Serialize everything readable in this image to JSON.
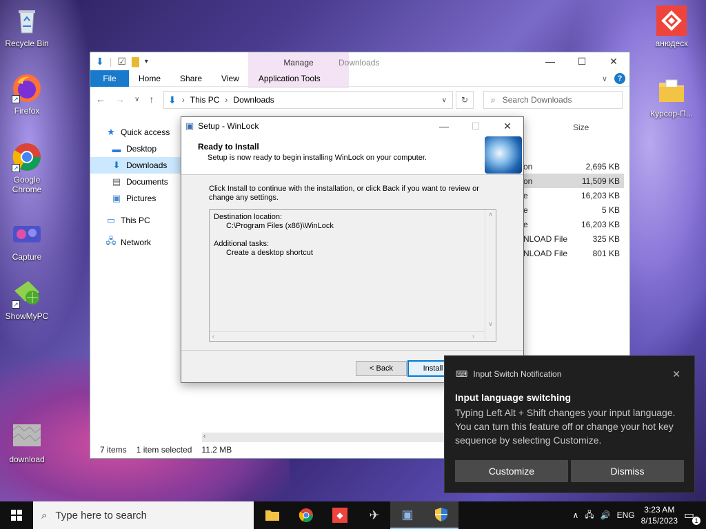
{
  "desktop": {
    "icons": [
      {
        "label": "Recycle Bin"
      },
      {
        "label": "Firefox"
      },
      {
        "label": "Google Chrome"
      },
      {
        "label": "Capture"
      },
      {
        "label": "ShowMyPC"
      },
      {
        "label": "download"
      },
      {
        "label": "анюдеск"
      },
      {
        "label": "Курсор-П..."
      }
    ]
  },
  "explorer": {
    "title": "Downloads",
    "manage_tab": "Manage",
    "ribbon_tabs": {
      "file": "File",
      "home": "Home",
      "share": "Share",
      "view": "View",
      "app_tools": "Application Tools"
    },
    "address": {
      "this_pc": "This PC",
      "downloads": "Downloads"
    },
    "search_placeholder": "Search Downloads",
    "nav": {
      "quick_access": "Quick access",
      "desktop": "Desktop",
      "downloads": "Downloads",
      "documents": "Documents",
      "pictures": "Pictures",
      "this_pc": "This PC",
      "network": "Network"
    },
    "size_header": "Size",
    "rows": [
      {
        "type": "on",
        "size": "2,695 KB"
      },
      {
        "type": "on",
        "size": "11,509 KB"
      },
      {
        "type": "e",
        "size": "16,203 KB"
      },
      {
        "type": "e",
        "size": "5 KB"
      },
      {
        "type": "e",
        "size": "16,203 KB"
      },
      {
        "type": "NLOAD File",
        "size": "325 KB"
      },
      {
        "type": "NLOAD File",
        "size": "801 KB"
      }
    ],
    "status": {
      "items": "7 items",
      "selected": "1 item selected",
      "size": "11.2 MB"
    }
  },
  "setup": {
    "title": "Setup - WinLock",
    "header_title": "Ready to Install",
    "header_sub": "Setup is now ready to begin installing WinLock on your computer.",
    "body_text": "Click Install to continue with the installation, or click Back if you want to review or change any settings.",
    "memo": {
      "dest_label": "Destination location:",
      "dest_value": "C:\\Program Files (x86)\\WinLock",
      "tasks_label": "Additional tasks:",
      "tasks_value": "Create a desktop shortcut"
    },
    "back_label": "< Back",
    "install_label": "Install"
  },
  "toast": {
    "header": "Input Switch Notification",
    "title": "Input language switching",
    "body": "Typing Left Alt + Shift changes your input language. You can turn this feature off or change your hot key sequence by selecting Customize.",
    "customize": "Customize",
    "dismiss": "Dismiss"
  },
  "taskbar": {
    "search_placeholder": "Type here to search",
    "lang": "ENG",
    "time": "3:23 AM",
    "date": "8/15/2023",
    "notif_count": "1"
  }
}
